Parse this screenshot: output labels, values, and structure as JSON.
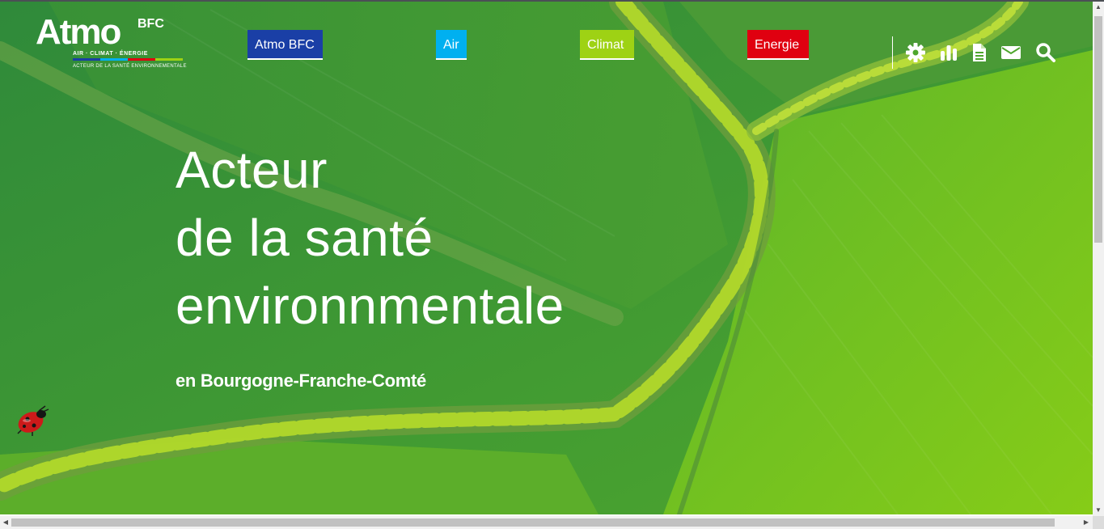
{
  "logo": {
    "word": "Atmo",
    "sup": "BFC",
    "tagline": "AIR · CLIMAT · ÉNERGIE",
    "subline": "ACTEUR DE LA SANTÉ ENVIRONNEMENTALE",
    "stripe_colors": [
      "#1a3fa6",
      "#00b0f0",
      "#e00010",
      "#9ed214"
    ]
  },
  "nav": {
    "items": [
      {
        "label": "Atmo BFC",
        "color": "#1a3fa6"
      },
      {
        "label": "Air",
        "color": "#00b0f0"
      },
      {
        "label": "Climat",
        "color": "#9ed214"
      },
      {
        "label": "Energie",
        "color": "#e00010"
      }
    ]
  },
  "tools": {
    "icons": [
      "gear-icon",
      "chart-icon",
      "document-icon",
      "envelope-icon",
      "search-icon"
    ]
  },
  "hero": {
    "headline": [
      "Acteur",
      "de la santé",
      "environnmentale"
    ],
    "subline": "en Bourgogne-Franche-Comté"
  },
  "bottom_bar_colors": [
    "#1a3fa6",
    "#e00010",
    "#9ed214"
  ]
}
